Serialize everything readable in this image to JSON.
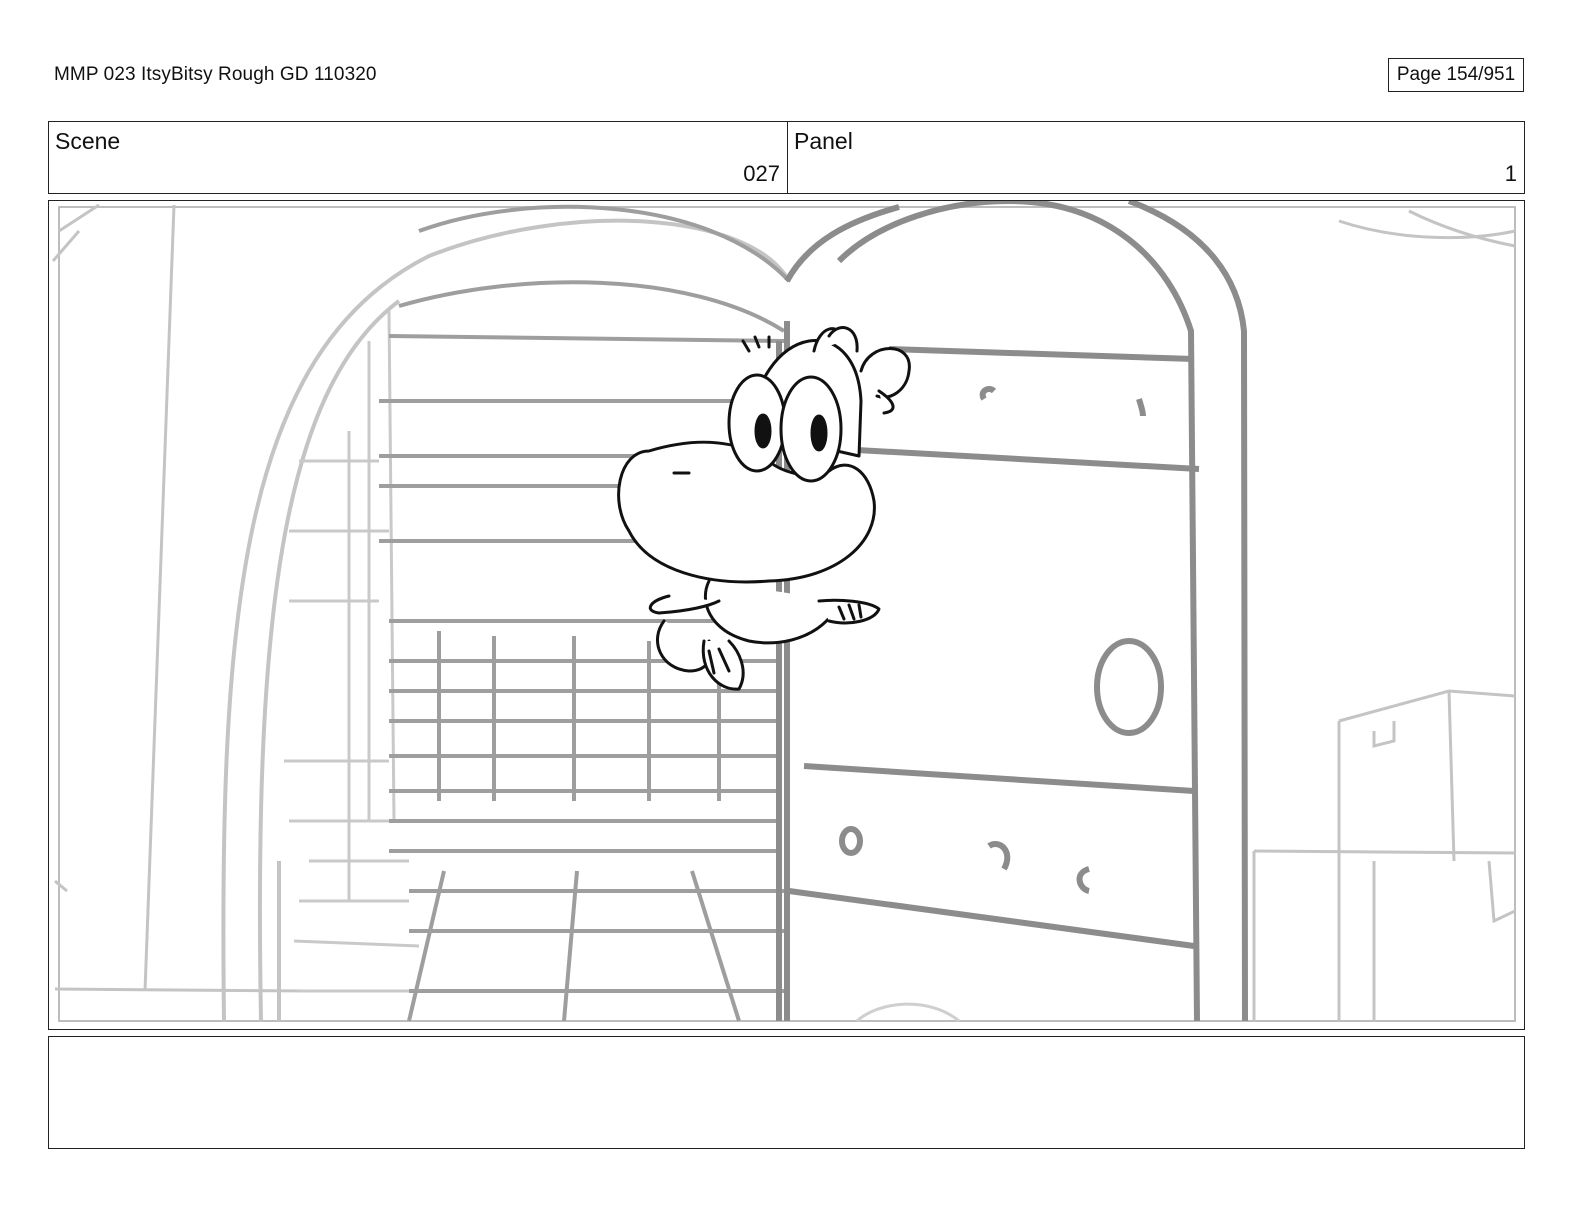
{
  "document": {
    "title": "MMP 023 ItsyBitsy Rough GD 110320",
    "page_label": "Page 154/951"
  },
  "header": {
    "scene_label": "Scene",
    "scene_value": "027",
    "panel_label": "Panel",
    "panel_value": "1"
  },
  "panel": {
    "image_name": "storyboard-sketch",
    "notes": ""
  },
  "colors": {
    "background_sketch": "#9a9a9a",
    "light_sketch": "#c4c4c4",
    "character_ink": "#111111"
  }
}
